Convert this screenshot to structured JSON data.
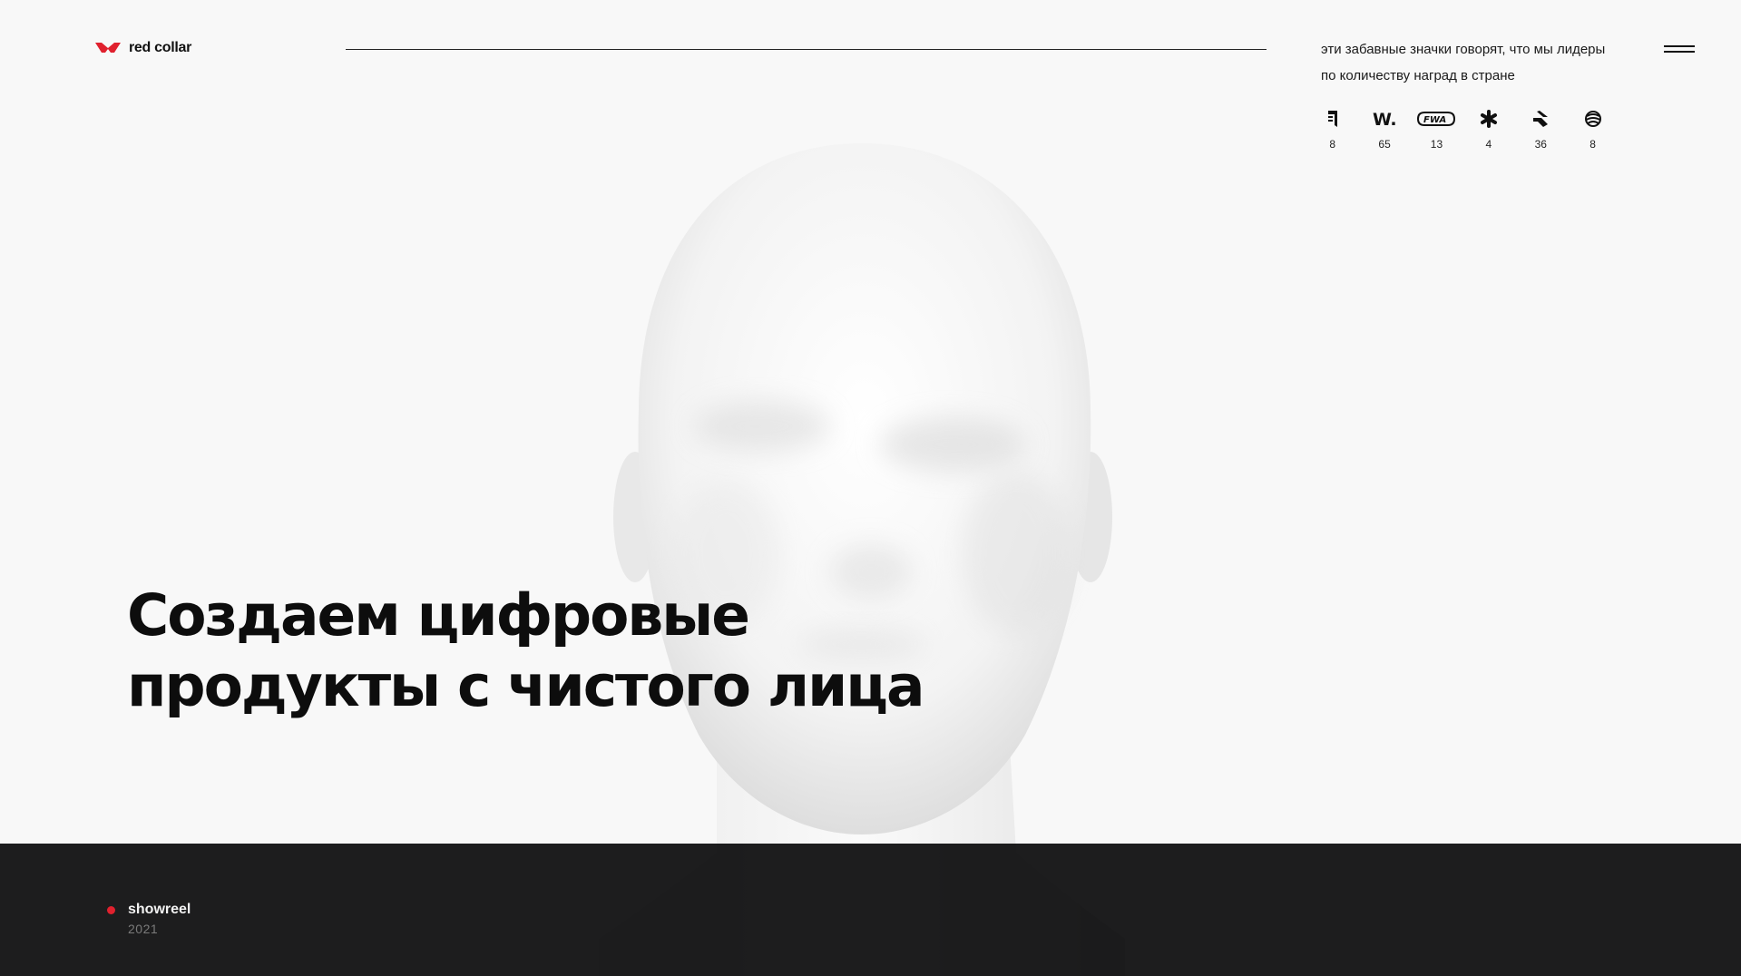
{
  "brand": {
    "name": "red collar",
    "accent_color": "#e0212e",
    "logo_icon": "red-collar-logo-icon"
  },
  "header": {
    "awards_note": "эти забавные значки говорят, что мы лидеры по количеству наград в стране",
    "menu_icon": "hamburger-menu-icon"
  },
  "awards": [
    {
      "icon": "css-design-awards-icon",
      "count": "8"
    },
    {
      "icon": "awwwards-icon",
      "count": "65"
    },
    {
      "icon": "fwa-icon",
      "count": "13"
    },
    {
      "icon": "asterisk-award-icon",
      "count": "4"
    },
    {
      "icon": "css-winner-icon",
      "count": "36"
    },
    {
      "icon": "globe-award-icon",
      "count": "8"
    }
  ],
  "hero": {
    "title_line1": "Создаем цифровые",
    "title_line2": "продукты с чистого лица"
  },
  "showreel": {
    "label": "showreel",
    "year": "2021"
  },
  "colors": {
    "background": "#f8f8f8",
    "band": "#0c0c0d",
    "text": "#0d0d0d"
  }
}
